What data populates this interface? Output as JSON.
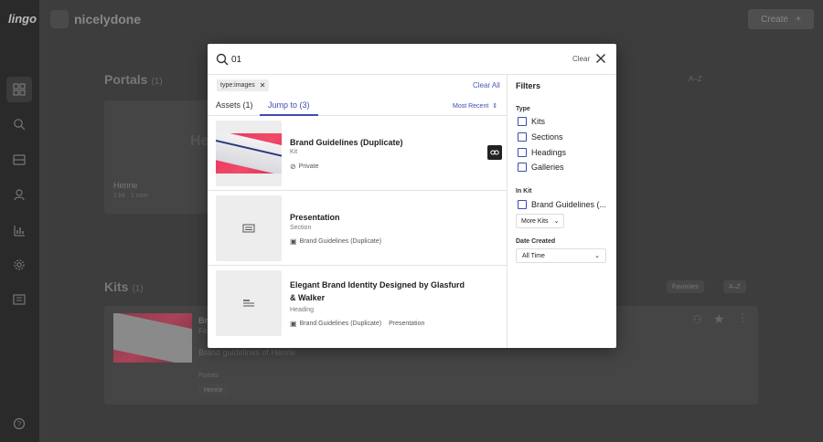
{
  "app": {
    "logo": "lingo"
  },
  "header": {
    "org_name": "nicelydone",
    "create_label": "Create"
  },
  "sections": {
    "portals": {
      "title": "Portals",
      "count": "(1)",
      "sort": "A–Z"
    },
    "kits": {
      "title": "Kits",
      "count": "(1)",
      "favorites": "Favorites",
      "sort": "A–Z"
    }
  },
  "portal_card": {
    "preview_text": "He",
    "name": "Henrie",
    "meta": "1 kit · 1 user"
  },
  "kit_card": {
    "name": "Br",
    "sub": "Fa",
    "description": "Brand guidelines of Henrie",
    "portals_label": "Portals",
    "portal_tag": "Henrie"
  },
  "search": {
    "value": "01",
    "clear_label": "Clear"
  },
  "filter_chips": [
    {
      "label": "type:images"
    }
  ],
  "clear_all_label": "Clear All",
  "tabs": [
    {
      "label": "Assets",
      "count": "(1)"
    },
    {
      "label": "Jump to",
      "count": "(3)"
    }
  ],
  "sort_label": "Most Recent",
  "results": [
    {
      "title": "Brand Guidelines (Duplicate)",
      "type": "Kit",
      "meta": "Private"
    },
    {
      "title": "Presentation",
      "type": "Section",
      "meta": "Brand Guidelines (Duplicate)"
    },
    {
      "title": "Elegant Brand Identity Designed by Glasfurd & Walker",
      "type": "Heading",
      "meta": "Brand Guidelines (Duplicate)",
      "meta2": "Presentation"
    }
  ],
  "filters": {
    "heading": "Filters",
    "type_label": "Type",
    "type_options": [
      "Kits",
      "Sections",
      "Headings",
      "Galleries"
    ],
    "in_kit_label": "In Kit",
    "kit_option": "Brand Guidelines (...",
    "more_kits_label": "More Kits",
    "date_label": "Date Created",
    "date_value": "All Time"
  },
  "colors": {
    "accent": "#3d4db0",
    "overlay": "#3a3a3a",
    "thumb_red": "#e8345a"
  }
}
